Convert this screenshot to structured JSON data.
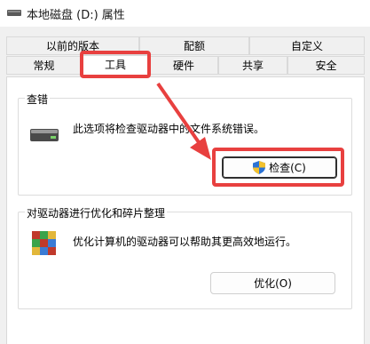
{
  "window": {
    "title": "本地磁盘 (D:) 属性"
  },
  "tabs": {
    "row1": [
      "以前的版本",
      "配额",
      "自定义"
    ],
    "row2": [
      "常规",
      "工具",
      "硬件",
      "共享",
      "安全"
    ],
    "active": "工具"
  },
  "error_check": {
    "group_title": "查错",
    "description": "此选项将检查驱动器中的文件系统错误。",
    "button_label": "检查(C)"
  },
  "optimize": {
    "group_title": "对驱动器进行优化和碎片整理",
    "description": "优化计算机的驱动器可以帮助其更高效地运行。",
    "button_label": "优化(O)"
  },
  "annotations": {
    "highlight_color": "#e8403f"
  }
}
